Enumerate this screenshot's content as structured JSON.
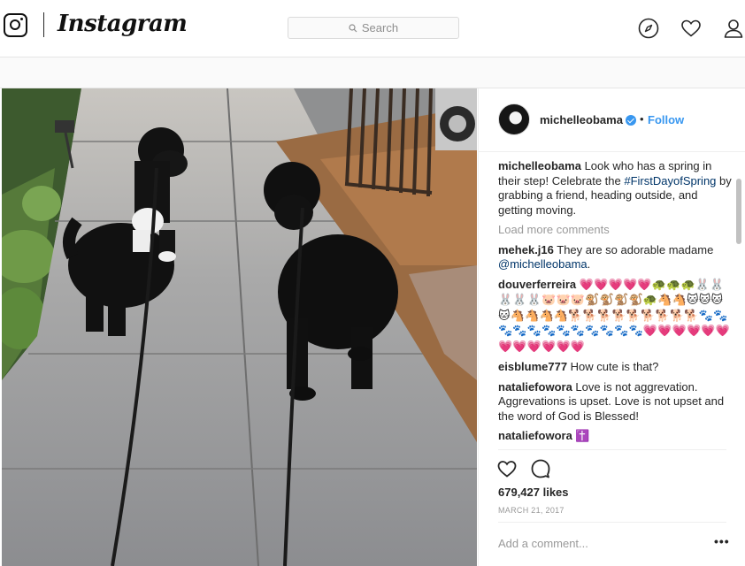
{
  "nav": {
    "brand": "Instagram",
    "search_placeholder": "Search"
  },
  "post": {
    "author": "michelleobama",
    "follow_label": "Follow",
    "separator": "•",
    "caption": {
      "user": "michelleobama",
      "text_before": "Look who has a spring in their step! Celebrate the ",
      "hashtag": "#FirstDayofSpring",
      "text_after": " by grabbing a friend, heading outside, and getting moving."
    },
    "load_more": "Load more comments",
    "comments": [
      {
        "user": "mehek.j16",
        "text_before": "They are so adorable madame ",
        "mention": "@michelleobama",
        "text_after": "."
      },
      {
        "user": "douverferreira",
        "text": "💗💗💗💗💗🐢🐢🐢🐰🐰🐰🐰🐰🐷🐷🐷🐒🐒🐒🐒🐢🐴🐴🐱🐱🐱🐱🐴🐴🐴🐴🐕🐕🐕🐕🐕🐕🐕🐕🐕🐾🐾🐾🐾🐾🐾🐾🐾🐾🐾🐾🐾💗💗💗💗💗💗💗💗💗💗💗💗"
      },
      {
        "user": "eisblume777",
        "text": "How cute is that?"
      },
      {
        "user": "nataliefowora",
        "text": "Love is not aggrevation. Aggrevations is upset. Love is not upset and the word of God is Blessed!"
      },
      {
        "user": "nataliefowora",
        "text": "✝️"
      }
    ],
    "likes": "679,427 likes",
    "date": "MARCH 21, 2017",
    "add_comment_placeholder": "Add a comment...",
    "more_label": "•••"
  },
  "colors": {
    "accent": "#3897f0",
    "link": "#003569",
    "muted": "#999999"
  },
  "icons": [
    "instagram-camera-icon",
    "search-icon",
    "compass-icon",
    "heart-icon",
    "profile-icon",
    "verified-badge-icon",
    "like-heart-icon",
    "comment-bubble-icon"
  ]
}
